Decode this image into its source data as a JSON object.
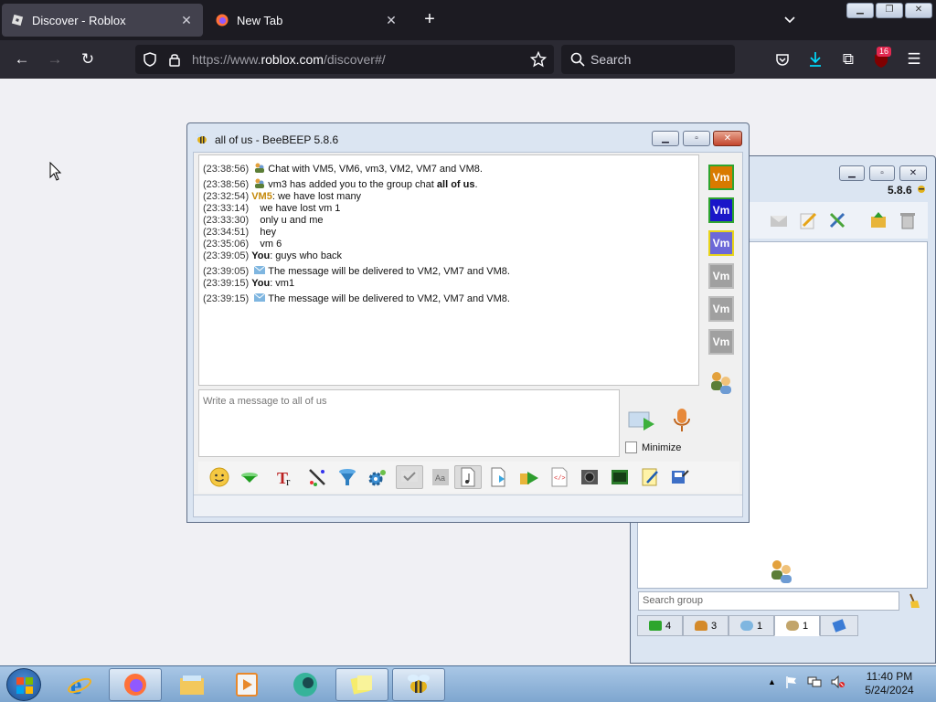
{
  "browser": {
    "tabs": [
      {
        "title": "Discover - Roblox",
        "active": true
      },
      {
        "title": "New Tab",
        "active": false
      }
    ],
    "new_tab": "+",
    "url_prefix": "https://www.",
    "url_domain": "roblox.com",
    "url_path": "/discover#/",
    "search_placeholder": "Search",
    "extension_badge": "16"
  },
  "chat_window": {
    "title": "all of us - BeeBEEP 5.8.6",
    "messages": [
      {
        "time": "(23:38:56)",
        "icon": "group-icon",
        "text": "Chat with VM5, VM6, vm3, VM2, VM7 and VM8."
      },
      {
        "time": "(23:38:56)",
        "icon": "group-icon",
        "text": "vm3 has added you to the group chat ",
        "bold": "all of us",
        "suffix": "."
      },
      {
        "time": "(23:32:54)",
        "sender": "VM5",
        "text": ": we have lost many"
      },
      {
        "time": "(23:33:14)",
        "indent": true,
        "text": "we have lost vm 1"
      },
      {
        "time": "(23:33:30)",
        "indent": true,
        "text": "only u and me"
      },
      {
        "time": "(23:34:51)",
        "indent": true,
        "text": "hey"
      },
      {
        "time": "(23:35:06)",
        "indent": true,
        "text": "vm 6"
      },
      {
        "time": "(23:39:05)",
        "you": "You",
        "text": ": guys who back"
      },
      {
        "time": "(23:39:05)",
        "icon": "envelope-icon",
        "text": "The message will be delivered to VM2, VM7 and VM8."
      },
      {
        "time": "(23:39:15)",
        "you": "You",
        "text": ": vm1"
      },
      {
        "time": "(23:39:15)",
        "icon": "envelope-icon",
        "text": "The message will be delivered to VM2, VM7 and VM8."
      }
    ],
    "members": [
      {
        "label": "Vm",
        "bg": "#d97a00",
        "border": "#2fa52f"
      },
      {
        "label": "Vm",
        "bg": "#1a16c9",
        "border": "#2fa52f"
      },
      {
        "label": "Vm",
        "bg": "#6c68d8",
        "border": "#e8d41a"
      },
      {
        "label": "Vm",
        "bg": "#a0a0a0",
        "border": "#bdbdbd"
      },
      {
        "label": "Vm",
        "bg": "#a0a0a0",
        "border": "#bdbdbd"
      },
      {
        "label": "Vm",
        "bg": "#a0a0a0",
        "border": "#bdbdbd"
      }
    ],
    "input_placeholder": "Write a message to all of us",
    "minimize_label": "Minimize",
    "toolbar_icons": [
      "smiley-icon",
      "green-arrow-icon",
      "text-format-icon",
      "color-pen-icon",
      "filter-icon",
      "settings-gear-icon",
      "spellcheck-icon",
      "font-icon",
      "send-file-icon",
      "save-icon",
      "forward-icon",
      "code-icon",
      "screenshot-icon",
      "film-icon",
      "notes-icon",
      "print-icon"
    ]
  },
  "back_window": {
    "version": "5.8.6",
    "search_placeholder": "Search group",
    "tabs": [
      {
        "icon": "user-green-icon",
        "count": "4"
      },
      {
        "icon": "users-icon",
        "count": "3"
      },
      {
        "icon": "chat-icon",
        "count": "1"
      },
      {
        "icon": "group-icon",
        "count": "1"
      },
      {
        "icon": "pin-icon",
        "count": ""
      }
    ]
  },
  "taskbar": {
    "time": "11:40 PM",
    "date": "5/24/2024"
  }
}
